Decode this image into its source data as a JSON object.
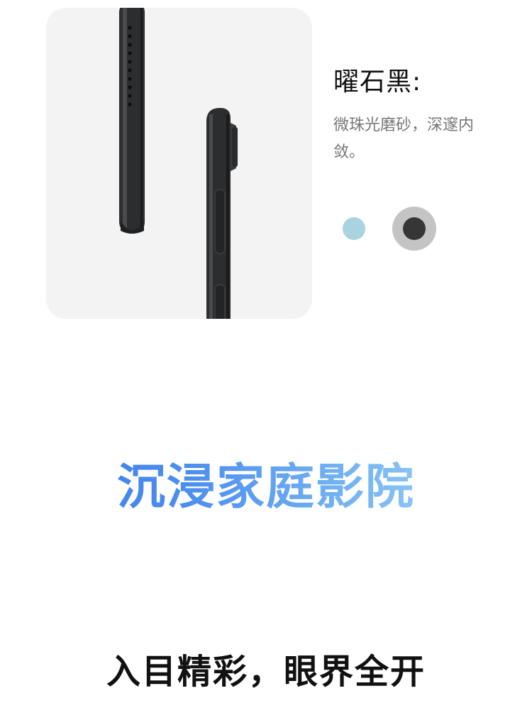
{
  "color_option": {
    "title": "曜石黑:",
    "description": "微珠光磨砂，深邃内敛。",
    "swatches": [
      {
        "name": "light-blue",
        "color": "#a9d3df",
        "selected": false
      },
      {
        "name": "obsidian-black",
        "color": "#363636",
        "selected": true
      }
    ]
  },
  "feature": {
    "heading": "沉浸家庭影院",
    "subheading": "入目精彩，眼界全开"
  },
  "colors": {
    "heading_gradient_start": "#3b78e6",
    "heading_gradient_end": "#b2e0fb",
    "card_background": "#f3f3f3"
  }
}
